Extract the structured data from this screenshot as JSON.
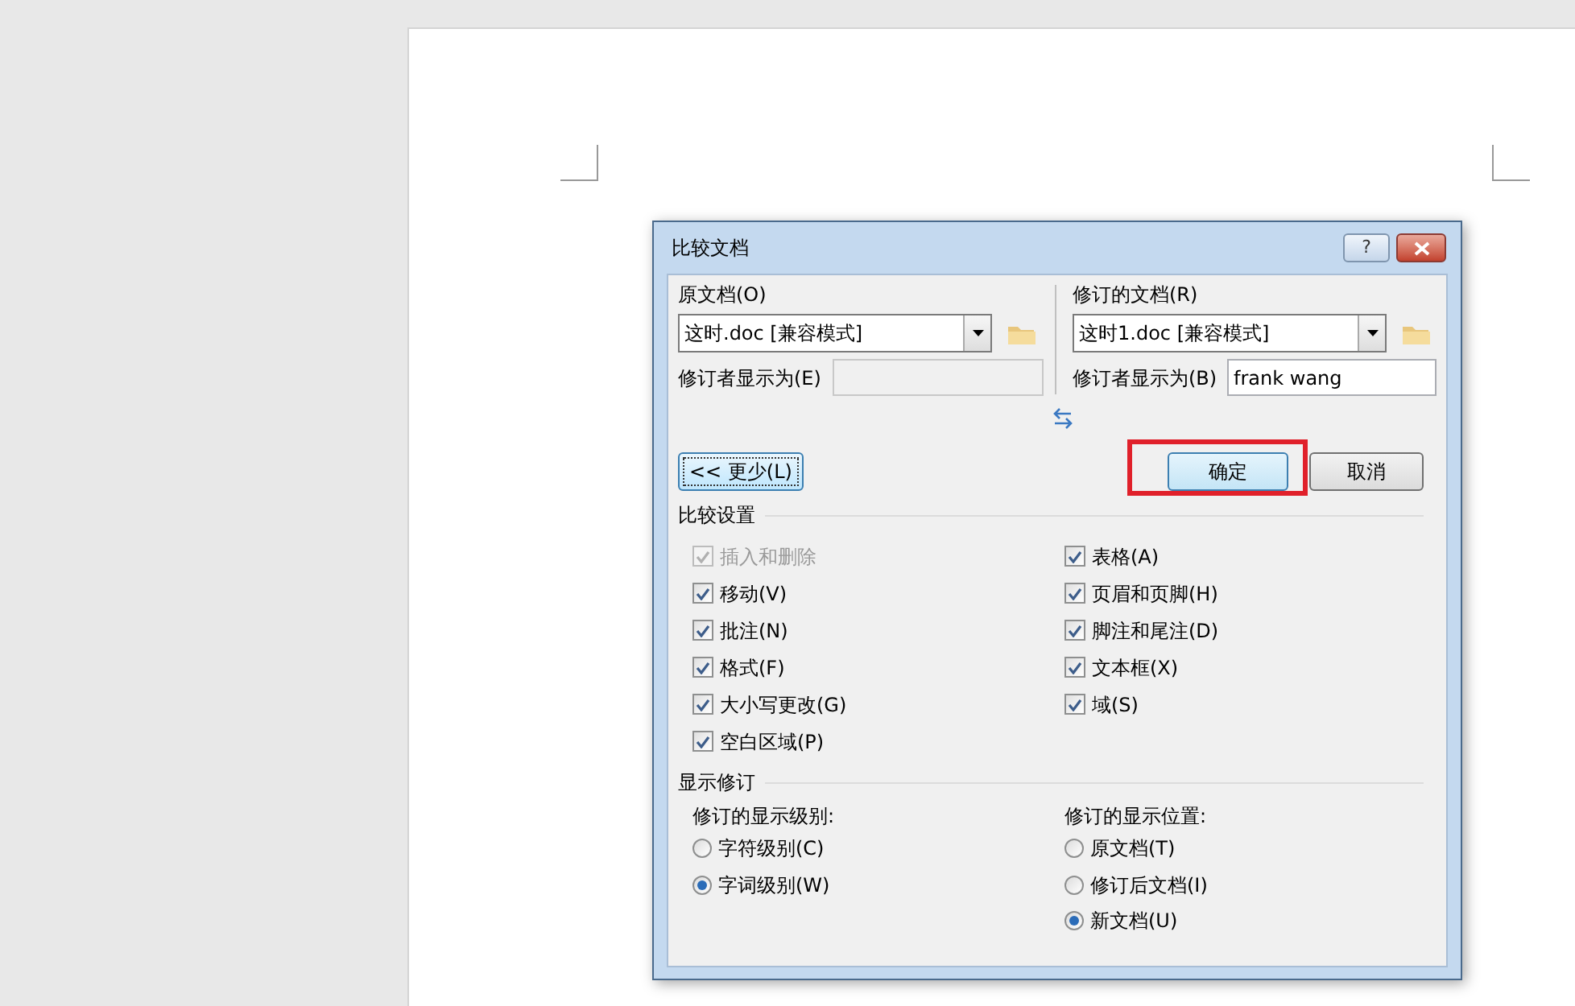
{
  "dialog": {
    "title": "比较文档",
    "help": "?",
    "original": {
      "label": "原文档(O)",
      "file": "这时.doc [兼容模式]",
      "reviewer_label": "修订者显示为(E)",
      "reviewer_disabled": true
    },
    "revised": {
      "label": "修订的文档(R)",
      "file": "这时1.doc [兼容模式]",
      "reviewer_label": "修订者显示为(B)",
      "reviewer_value": "frank wang",
      "reviewer_disabled": false
    },
    "less_button": "<< 更少(L)",
    "ok_button": {
      "label": "确定",
      "highlighted": true
    },
    "cancel_button": "取消",
    "compare_settings": {
      "title": "比较设置",
      "left": [
        {
          "label": "插入和删除",
          "checked": true,
          "disabled": true
        },
        {
          "label": "移动(V)",
          "checked": true,
          "disabled": false
        },
        {
          "label": "批注(N)",
          "checked": true,
          "disabled": false
        },
        {
          "label": "格式(F)",
          "checked": true,
          "disabled": false
        },
        {
          "label": "大小写更改(G)",
          "checked": true,
          "disabled": false
        },
        {
          "label": "空白区域(P)",
          "checked": true,
          "disabled": false
        }
      ],
      "right": [
        {
          "label": "表格(A)",
          "checked": true,
          "disabled": false
        },
        {
          "label": "页眉和页脚(H)",
          "checked": true,
          "disabled": false
        },
        {
          "label": "脚注和尾注(D)",
          "checked": true,
          "disabled": false
        },
        {
          "label": "文本框(X)",
          "checked": true,
          "disabled": false
        },
        {
          "label": "域(S)",
          "checked": true,
          "disabled": false
        }
      ]
    },
    "show_changes": {
      "title": "显示修订",
      "level": {
        "label": "修订的显示级别:",
        "options": [
          {
            "label": "字符级别(C)",
            "selected": false
          },
          {
            "label": "字词级别(W)",
            "selected": true
          }
        ]
      },
      "location": {
        "label": "修订的显示位置:",
        "options": [
          {
            "label": "原文档(T)",
            "selected": false
          },
          {
            "label": "修订后文档(I)",
            "selected": false
          },
          {
            "label": "新文档(U)",
            "selected": true
          }
        ]
      }
    }
  }
}
